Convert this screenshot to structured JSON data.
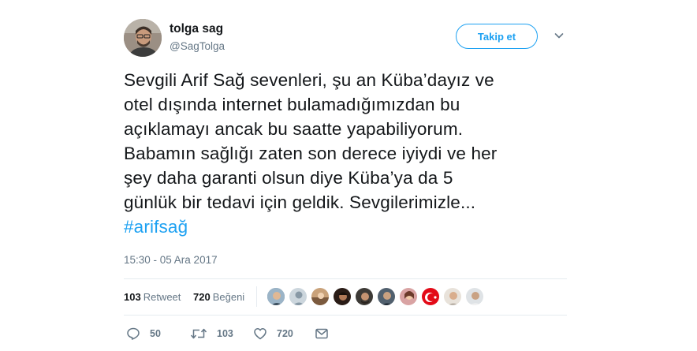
{
  "author": {
    "name": "tolga sag",
    "handle": "@SagTolga"
  },
  "follow_button_label": "Takip et",
  "tweet_lines": [
    "Sevgili Arif Sağ sevenleri, şu an Küba’dayız ve",
    "otel dışında internet bulamadığımızdan bu",
    "açıklamayı ancak bu saatte yapabiliyorum.",
    "Babamın sağlığı zaten son derece iyiydi ve her",
    "şey daha garanti olsun diye Küba’ya da 5",
    "günlük bir tedavi için geldik. Sevgilerimizle..."
  ],
  "hashtag": "#arifsağ",
  "timestamp": "15:30 - 05 Ara 2017",
  "stats": {
    "retweets_count": "103",
    "retweets_label": "Retweet",
    "likes_count": "720",
    "likes_label": "Beğeni"
  },
  "actions": {
    "replies": "50",
    "retweets": "103",
    "likes": "720"
  },
  "colors": {
    "accent": "#1da1f2",
    "text": "#14171a",
    "muted": "#657786",
    "divider": "#e6ecf0"
  },
  "icons": [
    "caret-down-icon",
    "reply-icon",
    "retweet-icon",
    "heart-icon",
    "message-icon"
  ]
}
